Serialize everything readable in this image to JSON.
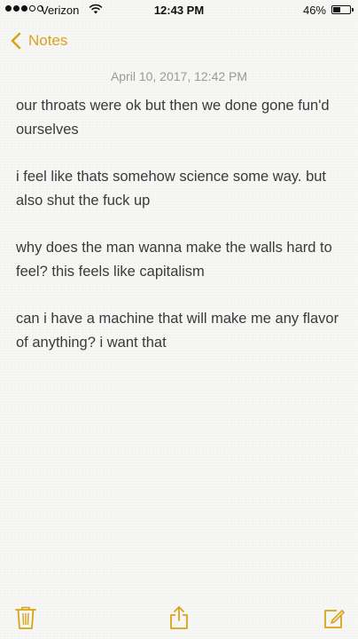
{
  "status_bar": {
    "carrier": "Verizon",
    "time": "12:43 PM",
    "battery_percent_label": "46%",
    "battery_level": 0.46,
    "signal_bars_filled": 3,
    "signal_bars_total": 5
  },
  "nav": {
    "back_label": "Notes",
    "accent_color": "#d9a317"
  },
  "note": {
    "date": "April 10, 2017, 12:42 PM",
    "paragraphs": [
      "our throats were ok but then we done gone fun'd ourselves",
      "i feel like thats somehow science some way. but also shut the fuck up",
      "why does the man wanna make the walls hard to feel? this feels like capitalism",
      "can i have a machine that will make me any flavor of anything? i want that"
    ]
  },
  "toolbar": {
    "icons": [
      "trash-icon",
      "share-icon",
      "compose-icon"
    ]
  }
}
